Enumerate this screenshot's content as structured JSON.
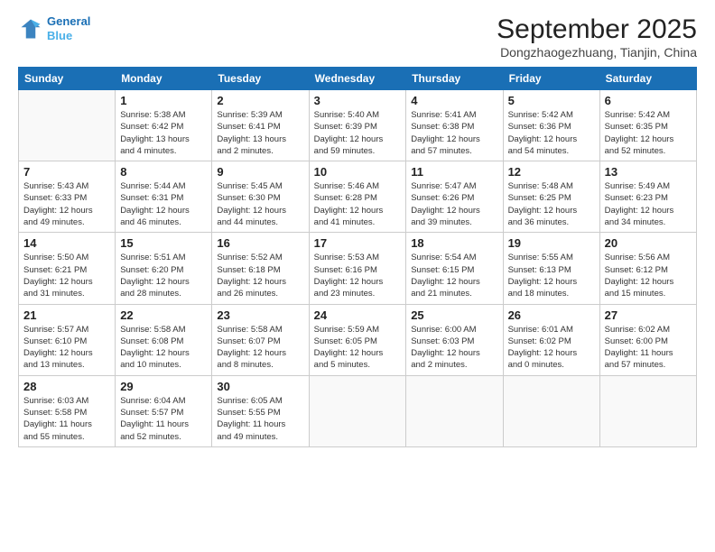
{
  "header": {
    "logo_line1": "General",
    "logo_line2": "Blue",
    "month_title": "September 2025",
    "location": "Dongzhaogezhuang, Tianjin, China"
  },
  "weekdays": [
    "Sunday",
    "Monday",
    "Tuesday",
    "Wednesday",
    "Thursday",
    "Friday",
    "Saturday"
  ],
  "weeks": [
    [
      {
        "day": "",
        "info": ""
      },
      {
        "day": "1",
        "info": "Sunrise: 5:38 AM\nSunset: 6:42 PM\nDaylight: 13 hours\nand 4 minutes."
      },
      {
        "day": "2",
        "info": "Sunrise: 5:39 AM\nSunset: 6:41 PM\nDaylight: 13 hours\nand 2 minutes."
      },
      {
        "day": "3",
        "info": "Sunrise: 5:40 AM\nSunset: 6:39 PM\nDaylight: 12 hours\nand 59 minutes."
      },
      {
        "day": "4",
        "info": "Sunrise: 5:41 AM\nSunset: 6:38 PM\nDaylight: 12 hours\nand 57 minutes."
      },
      {
        "day": "5",
        "info": "Sunrise: 5:42 AM\nSunset: 6:36 PM\nDaylight: 12 hours\nand 54 minutes."
      },
      {
        "day": "6",
        "info": "Sunrise: 5:42 AM\nSunset: 6:35 PM\nDaylight: 12 hours\nand 52 minutes."
      }
    ],
    [
      {
        "day": "7",
        "info": "Sunrise: 5:43 AM\nSunset: 6:33 PM\nDaylight: 12 hours\nand 49 minutes."
      },
      {
        "day": "8",
        "info": "Sunrise: 5:44 AM\nSunset: 6:31 PM\nDaylight: 12 hours\nand 46 minutes."
      },
      {
        "day": "9",
        "info": "Sunrise: 5:45 AM\nSunset: 6:30 PM\nDaylight: 12 hours\nand 44 minutes."
      },
      {
        "day": "10",
        "info": "Sunrise: 5:46 AM\nSunset: 6:28 PM\nDaylight: 12 hours\nand 41 minutes."
      },
      {
        "day": "11",
        "info": "Sunrise: 5:47 AM\nSunset: 6:26 PM\nDaylight: 12 hours\nand 39 minutes."
      },
      {
        "day": "12",
        "info": "Sunrise: 5:48 AM\nSunset: 6:25 PM\nDaylight: 12 hours\nand 36 minutes."
      },
      {
        "day": "13",
        "info": "Sunrise: 5:49 AM\nSunset: 6:23 PM\nDaylight: 12 hours\nand 34 minutes."
      }
    ],
    [
      {
        "day": "14",
        "info": "Sunrise: 5:50 AM\nSunset: 6:21 PM\nDaylight: 12 hours\nand 31 minutes."
      },
      {
        "day": "15",
        "info": "Sunrise: 5:51 AM\nSunset: 6:20 PM\nDaylight: 12 hours\nand 28 minutes."
      },
      {
        "day": "16",
        "info": "Sunrise: 5:52 AM\nSunset: 6:18 PM\nDaylight: 12 hours\nand 26 minutes."
      },
      {
        "day": "17",
        "info": "Sunrise: 5:53 AM\nSunset: 6:16 PM\nDaylight: 12 hours\nand 23 minutes."
      },
      {
        "day": "18",
        "info": "Sunrise: 5:54 AM\nSunset: 6:15 PM\nDaylight: 12 hours\nand 21 minutes."
      },
      {
        "day": "19",
        "info": "Sunrise: 5:55 AM\nSunset: 6:13 PM\nDaylight: 12 hours\nand 18 minutes."
      },
      {
        "day": "20",
        "info": "Sunrise: 5:56 AM\nSunset: 6:12 PM\nDaylight: 12 hours\nand 15 minutes."
      }
    ],
    [
      {
        "day": "21",
        "info": "Sunrise: 5:57 AM\nSunset: 6:10 PM\nDaylight: 12 hours\nand 13 minutes."
      },
      {
        "day": "22",
        "info": "Sunrise: 5:58 AM\nSunset: 6:08 PM\nDaylight: 12 hours\nand 10 minutes."
      },
      {
        "day": "23",
        "info": "Sunrise: 5:58 AM\nSunset: 6:07 PM\nDaylight: 12 hours\nand 8 minutes."
      },
      {
        "day": "24",
        "info": "Sunrise: 5:59 AM\nSunset: 6:05 PM\nDaylight: 12 hours\nand 5 minutes."
      },
      {
        "day": "25",
        "info": "Sunrise: 6:00 AM\nSunset: 6:03 PM\nDaylight: 12 hours\nand 2 minutes."
      },
      {
        "day": "26",
        "info": "Sunrise: 6:01 AM\nSunset: 6:02 PM\nDaylight: 12 hours\nand 0 minutes."
      },
      {
        "day": "27",
        "info": "Sunrise: 6:02 AM\nSunset: 6:00 PM\nDaylight: 11 hours\nand 57 minutes."
      }
    ],
    [
      {
        "day": "28",
        "info": "Sunrise: 6:03 AM\nSunset: 5:58 PM\nDaylight: 11 hours\nand 55 minutes."
      },
      {
        "day": "29",
        "info": "Sunrise: 6:04 AM\nSunset: 5:57 PM\nDaylight: 11 hours\nand 52 minutes."
      },
      {
        "day": "30",
        "info": "Sunrise: 6:05 AM\nSunset: 5:55 PM\nDaylight: 11 hours\nand 49 minutes."
      },
      {
        "day": "",
        "info": ""
      },
      {
        "day": "",
        "info": ""
      },
      {
        "day": "",
        "info": ""
      },
      {
        "day": "",
        "info": ""
      }
    ]
  ]
}
